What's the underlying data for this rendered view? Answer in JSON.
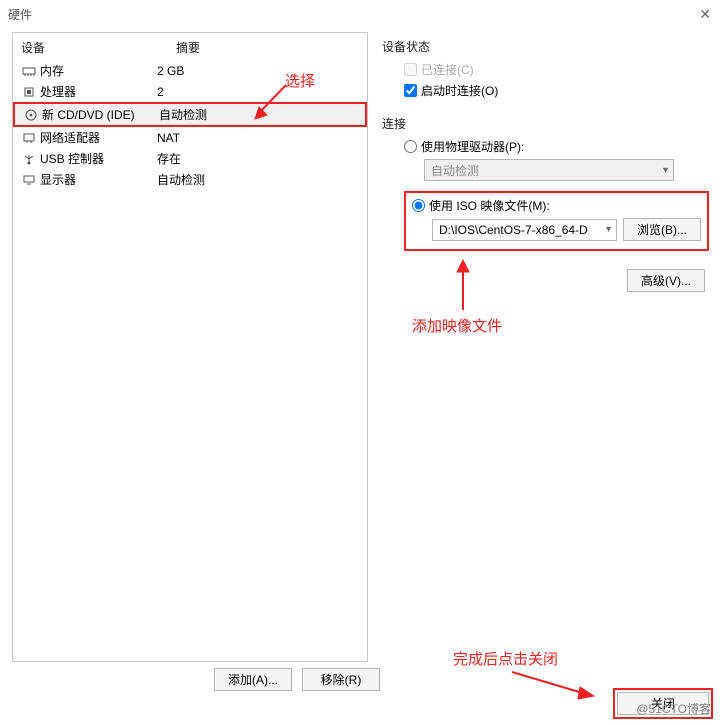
{
  "window": {
    "title": "硬件"
  },
  "left": {
    "head_device": "设备",
    "head_summary": "摘要",
    "rows": [
      {
        "icon": "memory",
        "device": "内存",
        "summary": "2 GB"
      },
      {
        "icon": "cpu",
        "device": "处理器",
        "summary": "2"
      },
      {
        "icon": "cd",
        "device": "新 CD/DVD (IDE)",
        "summary": "自动检测"
      },
      {
        "icon": "net",
        "device": "网络适配器",
        "summary": "NAT"
      },
      {
        "icon": "usb",
        "device": "USB 控制器",
        "summary": "存在"
      },
      {
        "icon": "display",
        "device": "显示器",
        "summary": "自动检测"
      }
    ],
    "add_btn": "添加(A)...",
    "remove_btn": "移除(R)"
  },
  "right": {
    "status_title": "设备状态",
    "connected": "已连接(C)",
    "connect_at_power_on": "启动时连接(O)",
    "connection_title": "连接",
    "use_physical": "使用物理驱动器(P):",
    "physical_value": "自动检测",
    "use_iso": "使用 ISO 映像文件(M):",
    "iso_value": "D:\\IOS\\CentOS-7-x86_64-D",
    "browse_btn": "浏览(B)...",
    "advanced_btn": "高级(V)..."
  },
  "footer": {
    "close_btn": "关闭",
    "watermark": "@51CTO博客"
  },
  "annotations": {
    "select": "选择",
    "add_image": "添加映像文件",
    "click_close": "完成后点击关闭"
  }
}
